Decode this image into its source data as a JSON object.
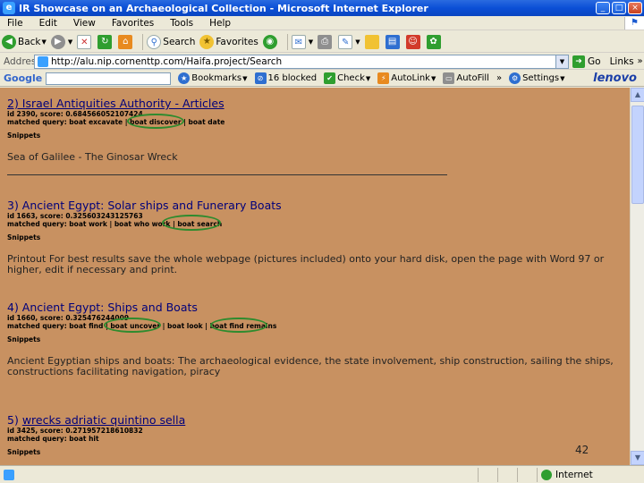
{
  "window": {
    "title": "IR Showcase on an Archaeological Collection - Microsoft Internet Explorer",
    "minimize": "_",
    "maximize": "□",
    "close": "×"
  },
  "menu": [
    "File",
    "Edit",
    "View",
    "Favorites",
    "Tools",
    "Help"
  ],
  "toolbar": {
    "back_label": "Back",
    "search_label": "Search",
    "favorites_label": "Favorites"
  },
  "address": {
    "label": "Address",
    "url": "http://alu.nip.cornenttp.com/Haifa.project/Search",
    "go_label": "Go",
    "links_label": "Links"
  },
  "google_toolbar": {
    "logo": "Google",
    "bookmarks_label": "Bookmarks",
    "blocked_label": "16 blocked",
    "check_label": "Check",
    "autolink_label": "AutoLink",
    "autofill_label": "AutoFill",
    "settings_label": "Settings",
    "brand": "lenovo"
  },
  "results": [
    {
      "title": "2) Israel Antiquities Authority - Articles",
      "meta": "id 2390, score: 0.684566052107424",
      "query": "matched query: boat excavate | boat discover | boat date",
      "snippets_label": "Snippets",
      "snippet": "Sea of Galilee - The Ginosar Wreck"
    },
    {
      "title": "3) Ancient Egypt: Solar ships and Funerary Boats",
      "meta": "id 1663, score: 0.325603243125763",
      "query": "matched query: boat work | boat who work | boat search",
      "snippets_label": "Snippets",
      "snippet": "Printout For best results save the whole webpage (pictures included) onto your hard disk, open the page with Word 97 or higher, edit if necessary and print."
    },
    {
      "title": "4) Ancient Egypt: Ships and Boats",
      "meta": "id 1660, score: 0.325476244009",
      "query": "matched query: boat find | boat uncover | boat look | boat find remains",
      "snippets_label": "Snippets",
      "snippet": "Ancient Egyptian ships and boats: The archaeological evidence, the state involvement, ship construction, sailing the ships, constructions facilitating navigation, piracy"
    },
    {
      "title_prefix": "5) ",
      "title": "wrecks adriatic quintino sella",
      "meta": "id 3425, score: 0.271957218610832",
      "query": "matched query: boat hit",
      "snippets_label": "Snippets"
    }
  ],
  "slide_number": "42",
  "status": {
    "zone_label": "Internet"
  },
  "colors": {
    "page_background": "#c89161",
    "annotation_circle": "#2e8b2e"
  }
}
